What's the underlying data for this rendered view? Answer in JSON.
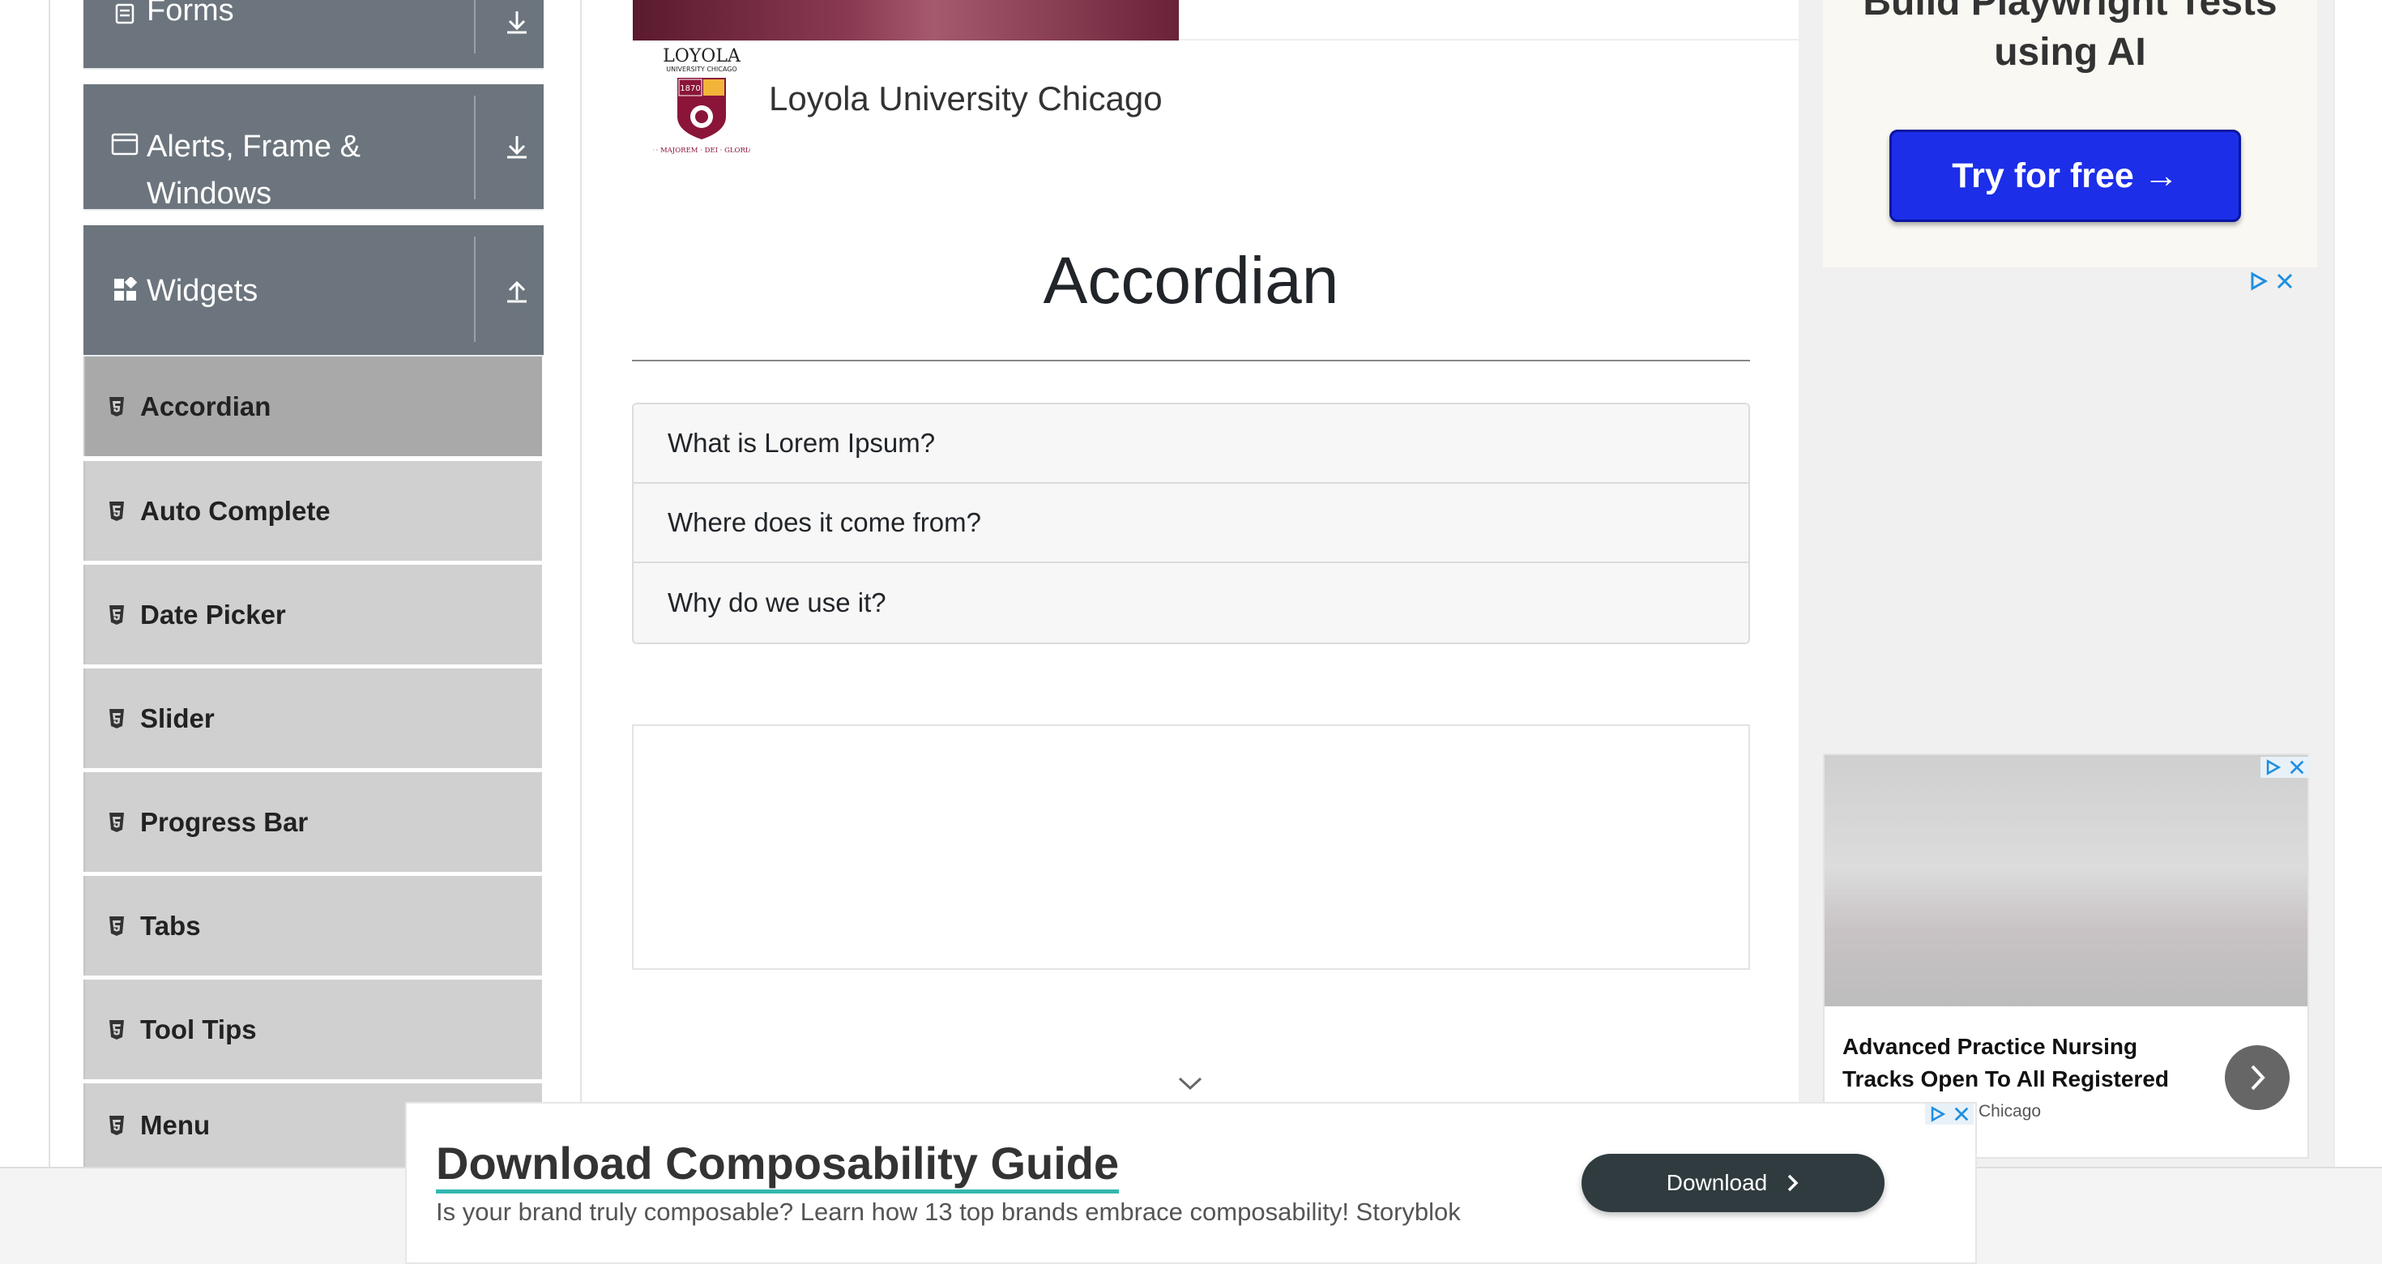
{
  "sidebar": {
    "groups": [
      {
        "label": "Forms",
        "expanded": false
      },
      {
        "label": "Alerts, Frame & Windows",
        "expanded": false
      },
      {
        "label": "Widgets",
        "expanded": true
      }
    ],
    "items": [
      {
        "label": "Accordian",
        "active": true
      },
      {
        "label": "Auto Complete"
      },
      {
        "label": "Date Picker"
      },
      {
        "label": "Slider"
      },
      {
        "label": "Progress Bar"
      },
      {
        "label": "Tabs"
      },
      {
        "label": "Tool Tips"
      },
      {
        "label": "Menu"
      }
    ]
  },
  "header": {
    "logo_text": "LOYOLA",
    "logo_sub": "UNIVERSITY CHICAGO",
    "logo_year": "1870",
    "logo_motto": "AD · MAJOREM · DEI · GLORIAM",
    "sponsor_name": "Loyola University Chicago"
  },
  "main": {
    "title": "Accordian",
    "accordion": [
      {
        "label": "What is Lorem Ipsum?"
      },
      {
        "label": "Where does it come from?"
      },
      {
        "label": "Why do we use it?"
      }
    ]
  },
  "ads": {
    "top": {
      "title": "Build Playwright Tests using AI",
      "cta": "Try for free →"
    },
    "card": {
      "title": "Advanced Practice Nursing Tracks Open To All Registered Nurses",
      "source": "Chicago"
    },
    "bottom": {
      "title": "Download Composability Guide",
      "subtitle": "Is your brand truly composable? Learn how 13 top brands embrace composability! Storyblok",
      "cta": "Download"
    }
  },
  "colors": {
    "sidebar_header": "#6c757d",
    "sidebar_item": "#d0d0d0",
    "sidebar_item_active": "#a9a9a9",
    "cta_blue": "#1c2ee8",
    "download_button": "#2f3b3f",
    "underline_accent": "#33b8b0"
  }
}
